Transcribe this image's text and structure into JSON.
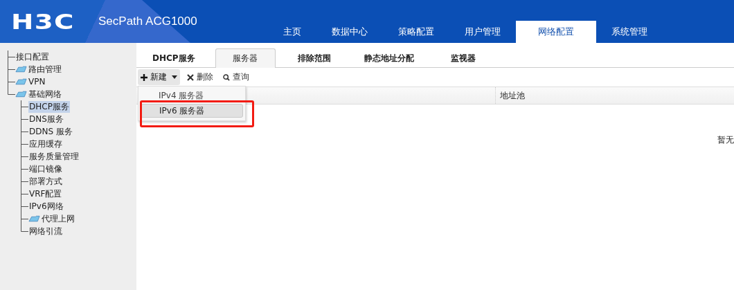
{
  "header": {
    "logo": "H3C",
    "product": "SecPath ACG1000"
  },
  "nav": [
    {
      "label": "主页",
      "selected": false
    },
    {
      "label": "数据中心",
      "selected": false
    },
    {
      "label": "策略配置",
      "selected": false
    },
    {
      "label": "用户管理",
      "selected": false
    },
    {
      "label": "网络配置",
      "selected": true
    },
    {
      "label": "系统管理",
      "selected": false
    }
  ],
  "sidebar": {
    "items": [
      {
        "label": "接口配置",
        "kind": "page",
        "selected": false
      },
      {
        "label": "路由管理",
        "kind": "folder",
        "selected": false
      },
      {
        "label": "VPN",
        "kind": "folder",
        "selected": false
      },
      {
        "label": "基础网络",
        "kind": "folder",
        "selected": false,
        "children": [
          {
            "label": "DHCP服务",
            "kind": "page",
            "selected": true
          },
          {
            "label": "DNS服务",
            "kind": "page",
            "selected": false
          },
          {
            "label": "DDNS 服务",
            "kind": "page",
            "selected": false
          },
          {
            "label": "应用缓存",
            "kind": "page",
            "selected": false
          },
          {
            "label": "服务质量管理",
            "kind": "page",
            "selected": false
          },
          {
            "label": "端口镜像",
            "kind": "page",
            "selected": false
          },
          {
            "label": "部署方式",
            "kind": "page",
            "selected": false
          },
          {
            "label": "VRF配置",
            "kind": "page",
            "selected": false
          },
          {
            "label": "IPv6网络",
            "kind": "page",
            "selected": false
          },
          {
            "label": "代理上网",
            "kind": "folder",
            "selected": false
          },
          {
            "label": "网络引流",
            "kind": "page",
            "selected": false
          }
        ]
      }
    ]
  },
  "tabs": [
    {
      "label": "DHCP服务",
      "selected": false
    },
    {
      "label": "服务器",
      "selected": true
    },
    {
      "label": "排除范围",
      "selected": false
    },
    {
      "label": "静态地址分配",
      "selected": false
    },
    {
      "label": "监视器",
      "selected": false
    }
  ],
  "toolbar": {
    "new": "新建",
    "delete": "删除",
    "query": "查询"
  },
  "menu": [
    {
      "label": "IPv4 服务器",
      "selected": false
    },
    {
      "label": "IPv6 服务器",
      "selected": true
    }
  ],
  "table": {
    "columns": [
      "地址池"
    ],
    "empty": "暂无"
  }
}
